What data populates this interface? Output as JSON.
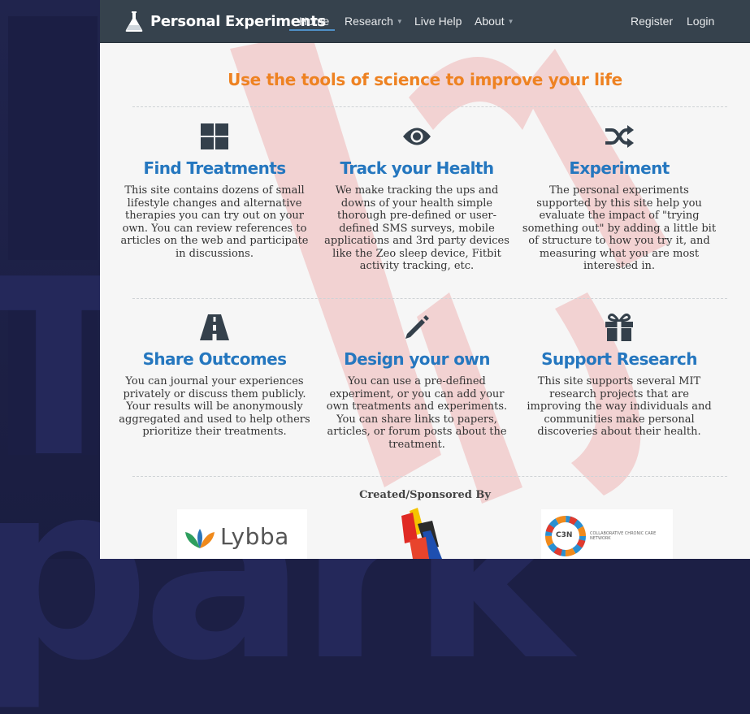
{
  "brand": {
    "name": "Personal Experiments"
  },
  "nav": {
    "home": "Home",
    "research": "Research",
    "live_help": "Live Help",
    "about": "About",
    "register": "Register",
    "login": "Login"
  },
  "tagline": "Use the tools of science to improve your life",
  "features": [
    {
      "icon": "grid-icon",
      "title": "Find Treatments",
      "text": "This site contains dozens of small lifestyle changes and alternative therapies you can try out on your own. You can review references to articles on the web and participate in discussions."
    },
    {
      "icon": "eye-icon",
      "title": "Track your Health",
      "text": "We make tracking the ups and downs of your health simple thorough pre-defined or user-defined SMS surveys, mobile applications and 3rd party devices like the Zeo sleep device, Fitbit activity tracking, etc."
    },
    {
      "icon": "shuffle-icon",
      "title": "Experiment",
      "text": "The personal experiments supported by this site help you evaluate the impact of \"trying something out\" by adding a little bit of structure to how you try it, and measuring what you are most interested in."
    },
    {
      "icon": "road-icon",
      "title": "Share Outcomes",
      "text": "You can journal your experiences privately or discuss them publicly. Your results will be anonymously aggregated and used to help others prioritize their treatments."
    },
    {
      "icon": "pencil-icon",
      "title": "Design your own",
      "text": "You can use a pre-defined experiment, or you can add your own treatments and experiments. You can share links to papers, articles, or forum posts about the treatment."
    },
    {
      "icon": "gift-icon",
      "title": "Support Research",
      "text": "This site supports several MIT research projects that are improving the way individuals and communities make personal discoveries about their health."
    }
  ],
  "sponsors": {
    "heading": "Created/Sponsored By",
    "lybba": "Lybba",
    "c3n_abbrev": "C3N",
    "c3n_name": "COLLABORATIVE CHRONIC CARE NETWORK"
  },
  "colors": {
    "navbar": "#36424d",
    "accent_orange": "#ee8222",
    "heading_blue": "#2577bf",
    "icon_dark": "#34404b"
  }
}
